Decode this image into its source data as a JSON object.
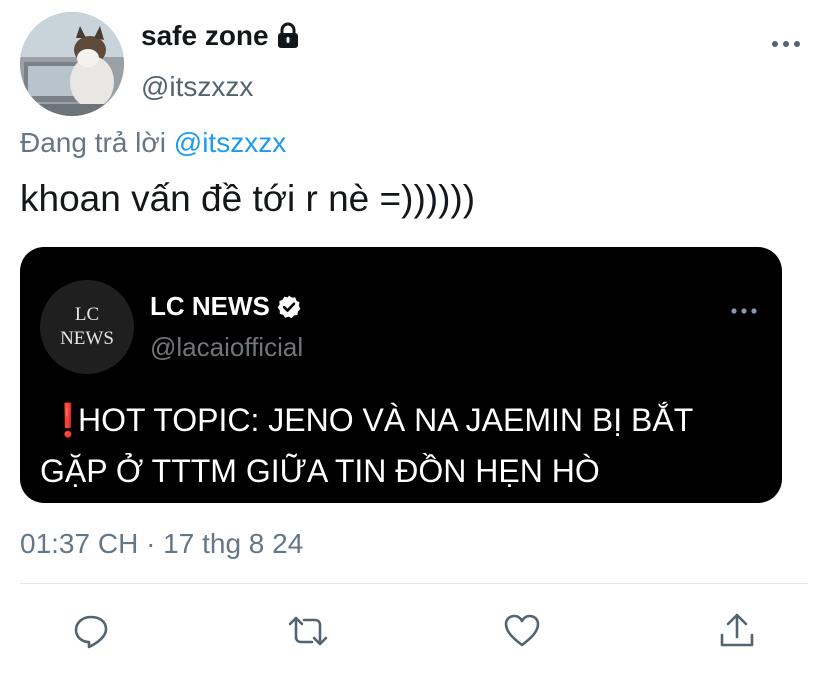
{
  "tweet": {
    "author": {
      "display_name": "safe zone",
      "handle": "@itszxzx",
      "protected_icon": "lock-icon"
    },
    "replying_to": {
      "prefix": "Đang trả lời",
      "mention": "@itszxzx"
    },
    "text": "khoan vấn đề tới r nè =))))))",
    "quoted": {
      "avatar_line1": "LC",
      "avatar_line2": "NEWS",
      "display_name": "LC NEWS",
      "handle": "@lacaiofficial",
      "verified_icon": "verified-badge-icon",
      "emoji": "❗",
      "text": "HOT TOPIC: JENO VÀ NA JAEMIN BỊ BẮT GẶP Ở TTTM GIỮA TIN ĐỒN HẸN HÒ"
    },
    "timestamp": "01:37 CH · 17 thg 8 24"
  },
  "actions": [
    {
      "icon": "reply-icon"
    },
    {
      "icon": "retweet-icon"
    },
    {
      "icon": "like-icon"
    },
    {
      "icon": "share-icon"
    }
  ],
  "colors": {
    "accent": "#1d9bf0",
    "secondary_text": "#657786",
    "card_background": "#000000",
    "alert_red": "#e0322b"
  }
}
